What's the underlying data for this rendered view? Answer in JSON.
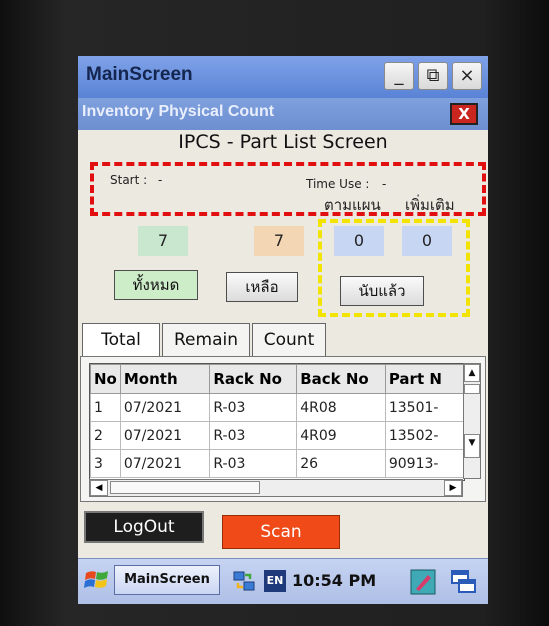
{
  "window": {
    "title": "MainScreen",
    "minimize_symbol": "_",
    "restore_symbol": "⧉",
    "close_symbol": "×"
  },
  "form": {
    "title": "Inventory Physical Count",
    "close_symbol": "X",
    "heading": "IPCS - Part List Screen"
  },
  "info": {
    "start_label": "Start :",
    "start_value": "-",
    "timeuse_label": "Time Use :",
    "timeuse_value": "-",
    "plan_label": "ตามแผน",
    "extra_label": "เพิ่มเติม"
  },
  "counts": {
    "total": "7",
    "remain": "7",
    "counted_plan": "0",
    "counted_extra": "0"
  },
  "buttons": {
    "all": "ทั้งหมด",
    "remain": "เหลือ",
    "counted": "นับแล้ว",
    "logout": "LogOut",
    "scan": "Scan"
  },
  "tabs": [
    "Total",
    "Remain",
    "Count"
  ],
  "table": {
    "headers": [
      "No",
      "Month",
      "Rack No",
      "Back No",
      "Part N"
    ],
    "rows": [
      [
        "1",
        "07/2021",
        "R-03",
        "4R08",
        "13501-"
      ],
      [
        "2",
        "07/2021",
        "R-03",
        "4R09",
        "13502-"
      ],
      [
        "3",
        "07/2021",
        "R-03",
        "26",
        "90913-"
      ]
    ]
  },
  "taskbar": {
    "app": "MainScreen",
    "lang": "EN",
    "time": "10:54 PM"
  },
  "colors": {
    "total_box": "#c9e6cf",
    "remain_box": "#f3d6b4",
    "counted_box": "#c7d6f2",
    "all_button": "#cdecc8",
    "scan_button": "#ef4a17"
  }
}
